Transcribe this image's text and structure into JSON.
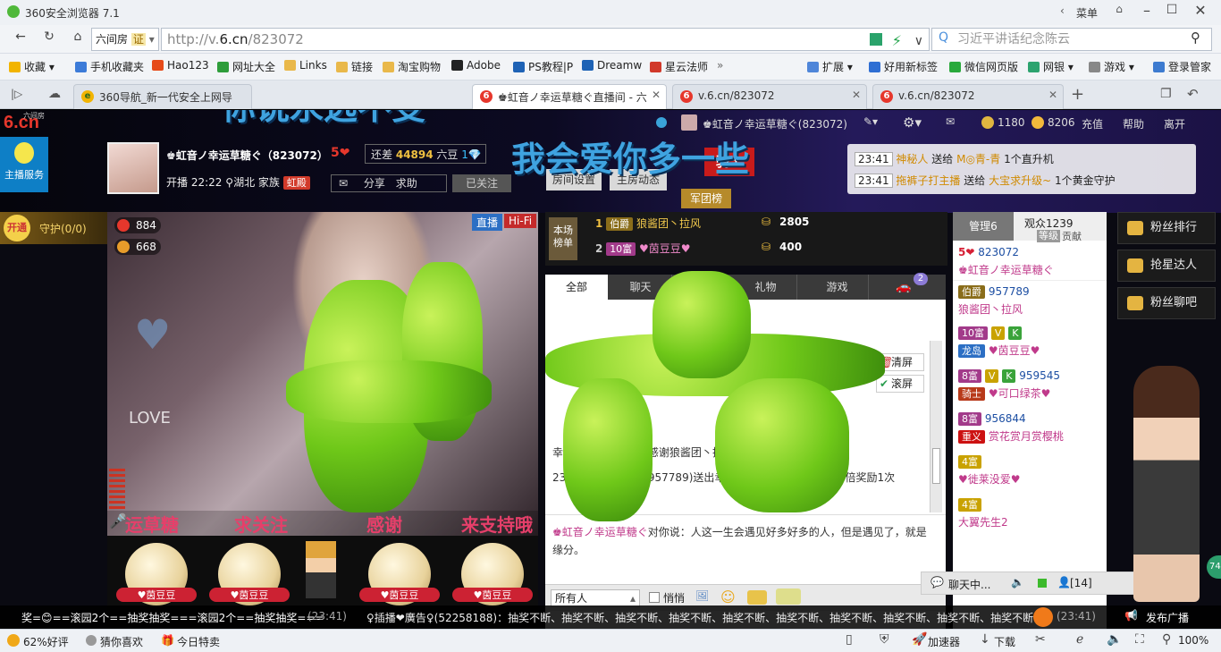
{
  "browser": {
    "title": "360安全浏览器 7.1",
    "menu_label": "菜单",
    "address_prefix": "六间房",
    "cert_label": "证",
    "url_host": "http://v.",
    "url_domain": "6.cn",
    "url_path": "/823072",
    "search_placeholder": "习近平讲话纪念陈云",
    "bookmarks": [
      {
        "label": "收藏",
        "color": "#f2b400"
      },
      {
        "label": "手机收藏夹",
        "color": "#3c7bd8"
      },
      {
        "label": "Hao123",
        "color": "#e64a19"
      },
      {
        "label": "网址大全",
        "color": "#2e9d3b"
      },
      {
        "label": "Links",
        "color": "#e9b84a"
      },
      {
        "label": "链接",
        "color": "#e9b84a"
      },
      {
        "label": "淘宝购物",
        "color": "#e9b84a"
      },
      {
        "label": "Adobe",
        "color": "#222"
      },
      {
        "label": "PS教程|P",
        "color": "#1e62b5"
      },
      {
        "label": "Dreamw",
        "color": "#1e62b5"
      },
      {
        "label": "星云法师",
        "color": "#d1392b"
      }
    ],
    "bookmarks_right": [
      {
        "label": "扩展",
        "color": "#4f86d9"
      },
      {
        "label": "好用新标签",
        "color": "#2f6fd3"
      },
      {
        "label": "微信网页版",
        "color": "#29a93c"
      },
      {
        "label": "网银",
        "color": "#2ca36f"
      },
      {
        "label": "游戏",
        "color": "#888"
      },
      {
        "label": "登录管家",
        "color": "#3d7bd0"
      }
    ],
    "tabs": [
      {
        "label": "360导航_新一代安全上网导",
        "active": false
      },
      {
        "label": "♚虹音ノ幸运草糖ぐ直播间 - 六",
        "active": true
      },
      {
        "label": "v.6.cn/823072",
        "active": false
      },
      {
        "label": "v.6.cn/823072",
        "active": false
      }
    ],
    "status": {
      "rating": "62%好评",
      "guess": "猜你喜欢",
      "today": "今日特卖",
      "accelerator": "加速器",
      "download": "下载",
      "zoom": "100%"
    }
  },
  "site": {
    "logo": "6.cn",
    "logo_sub": "六间房",
    "host_service": "主播服务",
    "open_label": "开通",
    "guard_label": "守护(0/0)",
    "top_user": "♚虹音ノ幸运草糖ぐ(823072)",
    "coins": "1180",
    "beans": "8206",
    "recharge": "充值",
    "help": "帮助",
    "leave": "离开",
    "host_name": "♚虹音ノ幸运草糖ぐ（823072）",
    "host_level": "5",
    "diff_label": "还差",
    "diff_value": "44894",
    "diff_unit": "六豆",
    "start_label": "开播",
    "start_time": "22:22",
    "location": "湖北",
    "family_label": "家族",
    "family_chip": "虹殿",
    "share_label": "分享",
    "ask_label": "求助",
    "followed_label": "已关注",
    "room_settings": "房间设置",
    "host_news": "主房动态",
    "knight_label": "骑士",
    "army_label": "军团榜",
    "overlay_text_1": "你说永远不变",
    "overlay_text_2": "我会爱你多一些",
    "gift_feed": [
      {
        "time": "23:41",
        "user": "神秘人",
        "verb": "送给",
        "target": "M◎青-青",
        "gift": "1个直升机"
      },
      {
        "time": "23:41",
        "user": "拖裤子打主播",
        "verb": "送给",
        "target": "大宝求升级~",
        "gift": "1个黄金守护"
      }
    ],
    "video": {
      "stat1": "884",
      "stat2": "668",
      "live_badge": "直播",
      "hifi_badge": "Hi-Fi",
      "scroll_text_1": "运草糖",
      "scroll_text_2": "求关注",
      "scroll_text_3": "感谢",
      "scroll_text_4": "来支持哦"
    },
    "gifts": [
      {
        "name": "♥茵豆豆"
      },
      {
        "name": "♥茵豆豆"
      },
      {
        "name": "♥茵豆豆"
      },
      {
        "name": "♥茵豆豆"
      }
    ],
    "rank": {
      "label_top": "本场",
      "label_bottom": "榜单",
      "rows": [
        {
          "rank": "1",
          "level": "伯爵",
          "name": "狼酱团丶拉风",
          "value": "2805"
        },
        {
          "rank": "2",
          "level": "10富",
          "name": "♥茵豆豆♥",
          "value": "400"
        }
      ]
    },
    "chat_tabs": [
      {
        "label": "全部"
      },
      {
        "label": "聊天"
      },
      {
        "label": "礼物"
      },
      {
        "label": "游戏"
      }
    ],
    "chat_badge": "2",
    "clear_label": "清屏",
    "scroll_label": "滚屏",
    "chat_messages": [
      {
        "text": "幸运芽，共258个，感谢狼酱团丶拉风的热情支持！"
      },
      {
        "text": "23:41 恭喜 狼酱团(957789)送出幸运芽获得 5倍奖励7次 10倍奖励1次"
      }
    ],
    "host_say_user": "♚虹音ノ幸运草糖ぐ",
    "host_say_text": "对你说：人这一生会遇见好多好多的人，但是遇见了，就是缘分。",
    "chat_target": "所有人",
    "whisper": "悄悄",
    "chat_bottom_label": "聊天中...",
    "chat_count": "[14]",
    "manage_label": "管理6",
    "audience_label": "观众1239",
    "level_label": "等级",
    "contrib_label": "贡献",
    "audience": [
      {
        "name": "823072",
        "level": "5"
      },
      {
        "name": "♚虹音ノ幸运草糖ぐ",
        "level": ""
      },
      {
        "name": "957789",
        "level": "伯爵"
      },
      {
        "name": "狼酱团丶拉风",
        "level": ""
      },
      {
        "name": "10富",
        "level": ""
      },
      {
        "name": "♥茵豆豆♥",
        "level": "龙岛"
      },
      {
        "name": "959545",
        "level": "8富"
      },
      {
        "name": "♥可口绿茶♥",
        "level": "骑士"
      },
      {
        "name": "956844",
        "level": "8富"
      },
      {
        "name": "赏花赏月赏樱桃",
        "level": "重义"
      },
      {
        "name": "♥徙莱没爱♥",
        "level": "4富"
      },
      {
        "name": "大翼先生2",
        "level": "4富"
      }
    ],
    "fans_rank": "粉丝排行",
    "star_talent": "抢星达人",
    "fans_chat": "粉丝聊吧",
    "side_badge": "74",
    "broadcast_label": "发布广播",
    "ticker_left": "奖=😊==滚园2个==抽奖抽奖===滚园2个==抽奖抽奖===",
    "ticker_time": "(23:41)",
    "ticker_mid": "♀插播❤廣告♀(52258188)：抽奖不断、抽奖不断、抽奖不断、抽奖不断、抽奖不断、抽奖不断、抽奖不断、抽奖不断、抽奖不断、抽奖不断、",
    "ticker_time2": "(23:41)"
  }
}
